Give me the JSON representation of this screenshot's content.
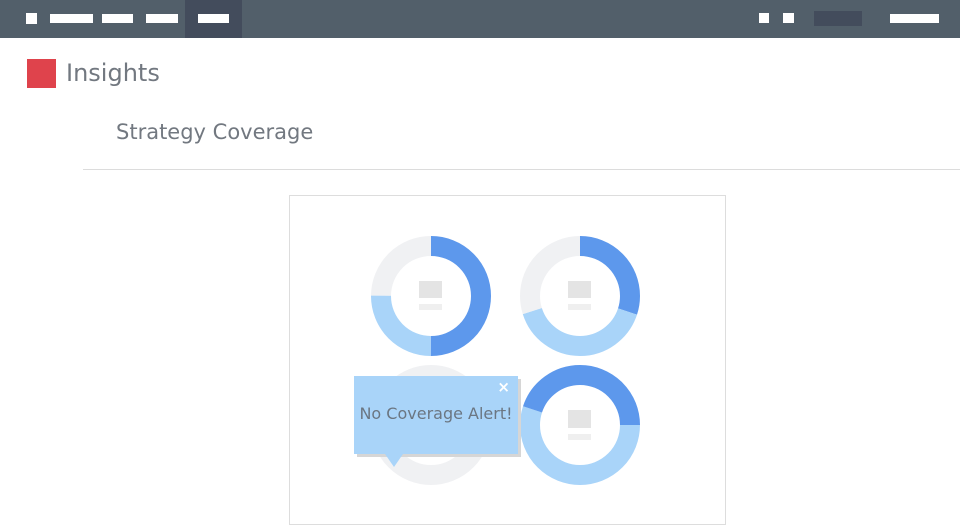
{
  "header": {
    "title": "Insights",
    "colors": {
      "bar": "#525f6a",
      "active": "#434c5c",
      "brand": "#df434c"
    },
    "nav_icon": "menu-icon",
    "right_icons": [
      "square-icon",
      "square-icon"
    ]
  },
  "section": {
    "title": "Strategy Coverage"
  },
  "coverage": {
    "donuts": [
      {
        "name": "donut-1",
        "segments": [
          {
            "fraction": 0.5,
            "color": "#5d98ec"
          },
          {
            "fraction": 0.25,
            "color": "#a9d4f9"
          },
          {
            "fraction": 0.25,
            "color": "#f0f1f3"
          }
        ]
      },
      {
        "name": "donut-2",
        "segments": [
          {
            "fraction": 0.3,
            "color": "#5d98ec"
          },
          {
            "fraction": 0.4,
            "color": "#a9d4f9"
          },
          {
            "fraction": 0.3,
            "color": "#f0f1f3"
          }
        ]
      },
      {
        "name": "donut-3",
        "segments": [
          {
            "fraction": 1.0,
            "color": "#f0f1f3"
          }
        ]
      },
      {
        "name": "donut-4",
        "segments": [
          {
            "fraction": 0.55,
            "color": "#a9d4f9"
          },
          {
            "fraction": 0.45,
            "color": "#5d98ec"
          }
        ]
      }
    ],
    "alert": {
      "message": "No Coverage Alert!",
      "close": "×"
    }
  }
}
